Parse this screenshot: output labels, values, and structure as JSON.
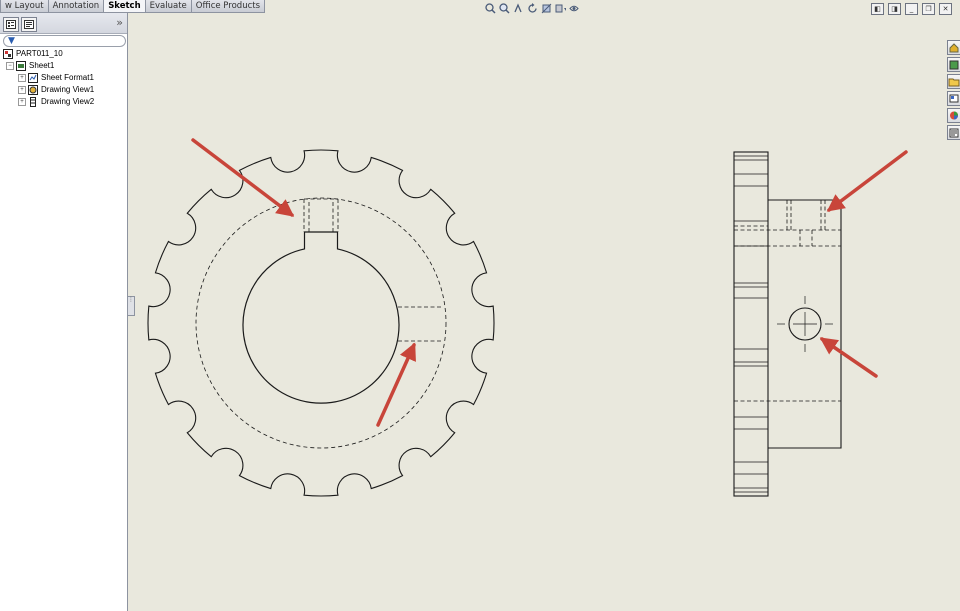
{
  "tabs": [
    {
      "label": "w Layout",
      "active": false
    },
    {
      "label": "Annotation",
      "active": false
    },
    {
      "label": "Sketch",
      "active": true
    },
    {
      "label": "Evaluate",
      "active": false
    },
    {
      "label": "Office Products",
      "active": false
    }
  ],
  "panel": {
    "more_glyph": "»",
    "filter_placeholder": ""
  },
  "tree": {
    "root": "PART011_10",
    "sheet": "Sheet1",
    "children": [
      "Sheet Format1",
      "Drawing View1",
      "Drawing View2"
    ]
  },
  "icons": {
    "view_toolbar": [
      "zoom-to-fit-icon",
      "zoom-area-icon",
      "previous-view-icon",
      "rotate-icon",
      "section-view-icon",
      "display-style-icon",
      "hide-show-icon"
    ],
    "window": [
      "tile-left-icon",
      "tile-right-icon",
      "minimize-icon",
      "restore-icon",
      "close-icon"
    ],
    "task_pane": [
      "home-icon",
      "design-library-icon",
      "file-explorer-icon",
      "view-palette-icon",
      "appearances-icon",
      "custom-properties-icon"
    ]
  },
  "colors": {
    "canvas": "#e9e8dd",
    "arrow": "#c8453a",
    "line": "#1a1a1a"
  }
}
